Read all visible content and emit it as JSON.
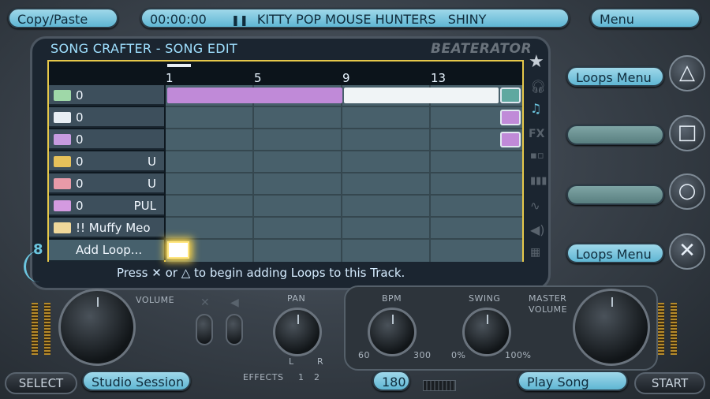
{
  "top_bar": {
    "copy_paste": "Copy/Paste",
    "time": "00:00:00",
    "song_title": "KITTY POP MOUSE HUNTERS   SHINY",
    "menu": "Menu"
  },
  "editor": {
    "title": "SONG CRAFTER - SONG EDIT",
    "brand": "BEATERATOR",
    "ruler": [
      "1",
      "5",
      "9",
      "13"
    ],
    "tracks": [
      {
        "label": "0",
        "suffix": "",
        "icon_color": "#9fd8a8"
      },
      {
        "label": "0",
        "suffix": "",
        "icon_color": "#e8eef4"
      },
      {
        "label": "0",
        "suffix": "",
        "icon_color": "#c79be0"
      },
      {
        "label": "0",
        "suffix": "U",
        "icon_color": "#e6c15a"
      },
      {
        "label": "0",
        "suffix": "U",
        "icon_color": "#e89aa8"
      },
      {
        "label": "0",
        "suffix": "PUL",
        "icon_color": "#d49ae0"
      },
      {
        "label": "!! Muffy Meo",
        "suffix": "",
        "icon_color": "#f0d89a"
      }
    ],
    "add_loop": "Add Loop...",
    "hint": "Press ✕ or △ to begin adding Loops to this Track.",
    "side_count": "8"
  },
  "right_menu": {
    "loops_menu_top": "Loops Menu",
    "loops_menu_bottom": "Loops Menu",
    "buttons": [
      "triangle-icon",
      "square-icon",
      "circle-icon",
      "cross-icon"
    ]
  },
  "mixer": {
    "volume_label": "VOLUME",
    "pan_label": "PAN",
    "bpm_label": "BPM",
    "swing_label": "SWING",
    "master_label_1": "MASTER",
    "master_label_2": "VOLUME",
    "effects_label": "EFFECTS",
    "effects_1": "1",
    "effects_2": "2",
    "pan_l": "L",
    "pan_r": "R",
    "bpm_min": "60",
    "bpm_max": "300",
    "swing_min": "0%",
    "swing_max": "100%"
  },
  "bottom_bar": {
    "select": "SELECT",
    "studio_session": "Studio Session",
    "bpm_value": "180",
    "play_song": "Play Song",
    "start": "START"
  },
  "colors": {
    "accent": "#6cc6e0",
    "grid_border": "#e6c84a",
    "loop_purple": "#c08ad8",
    "loop_white": "#f0f4f6"
  }
}
